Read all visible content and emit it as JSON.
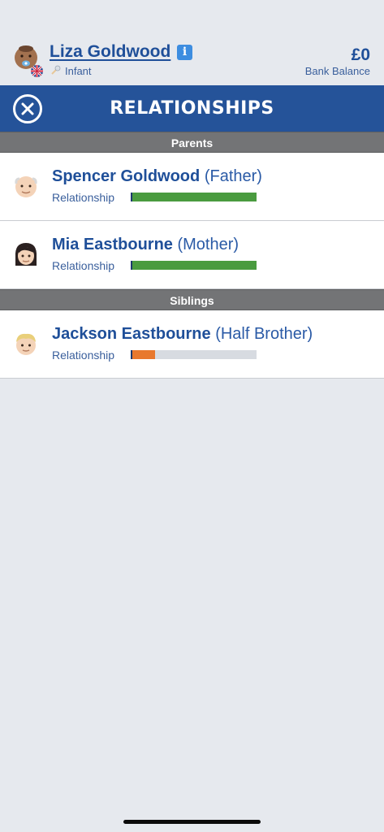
{
  "profile": {
    "name": "Liza Goldwood",
    "info_icon": "i",
    "life_stage": "Infant",
    "balance_value": "£0",
    "balance_label": "Bank Balance"
  },
  "header": {
    "title": "RELATIONSHIPS"
  },
  "sections": [
    {
      "title": "Parents",
      "people": [
        {
          "name": "Spencer Goldwood",
          "relation": "(Father)",
          "label": "Relationship",
          "level": 1.0,
          "bar_color": "#4a9b3f",
          "icon": "old-man-face-icon"
        },
        {
          "name": "Mia Eastbourne",
          "relation": "(Mother)",
          "label": "Relationship",
          "level": 1.0,
          "bar_color": "#4a9b3f",
          "icon": "woman-face-icon"
        }
      ]
    },
    {
      "title": "Siblings",
      "people": [
        {
          "name": "Jackson Eastbourne",
          "relation": "(Half Brother)",
          "label": "Relationship",
          "level": 0.18,
          "bar_color": "#e8782d",
          "icon": "boy-face-icon"
        }
      ]
    }
  ],
  "colors": {
    "brand_blue": "#255399",
    "section_gray": "#737476",
    "background": "#e6e9ee"
  }
}
